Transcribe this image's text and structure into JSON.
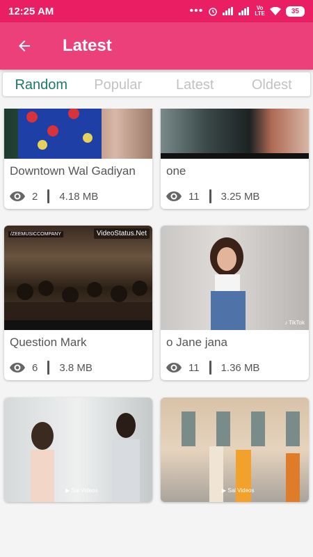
{
  "status_bar": {
    "time": "12:25 AM",
    "battery": "35",
    "volte_top": "Vo",
    "volte_bottom": "LTE"
  },
  "app_bar": {
    "title": "Latest"
  },
  "tabs": [
    {
      "label": "Random",
      "active": true
    },
    {
      "label": "Popular",
      "active": false
    },
    {
      "label": "Latest",
      "active": false
    },
    {
      "label": "Oldest",
      "active": false
    }
  ],
  "videos": [
    {
      "title": "Downtown Wal Gadiyan",
      "views": "2",
      "size": "4.18  MB"
    },
    {
      "title": "one",
      "views": "11",
      "size": "3.25  MB"
    },
    {
      "title": "Question Mark",
      "views": "6",
      "size": "3.8  MB",
      "watermark": "VideoStatus.Net",
      "watermark2": "/ZEEMUSICCOMPANY"
    },
    {
      "title": "o Jane jana",
      "views": "11",
      "size": "1.36  MB",
      "watermark": "♪ TikTok"
    },
    {
      "watermark": "▶ Sai Videos"
    },
    {
      "watermark": "▶ Sai Videos"
    }
  ],
  "colors": {
    "status_bar": "#e91e63",
    "app_bar": "#ec407a",
    "active_tab": "#1a7a6a",
    "inactive_tab": "#c2c2c2"
  }
}
